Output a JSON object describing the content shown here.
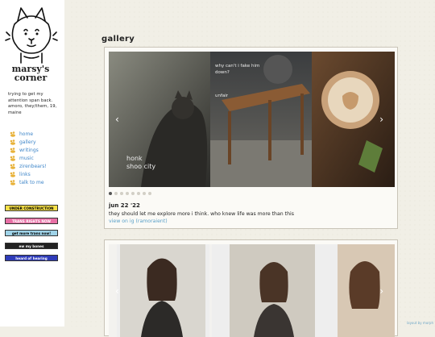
{
  "site": {
    "title_line1": "marsy's",
    "title_line2": "corner",
    "bio": "trying to get my attention span back. amoro, they/them, 19, maine"
  },
  "nav": {
    "items": [
      {
        "label": "home"
      },
      {
        "label": "gallery"
      },
      {
        "label": "writings"
      },
      {
        "label": "music"
      },
      {
        "label": "zirenbears!"
      },
      {
        "label": "links"
      },
      {
        "label": "talk to me"
      }
    ]
  },
  "badges": [
    {
      "label": "UNDER CONSTRUCTION"
    },
    {
      "label": "TRANS RIGHTS NOW"
    },
    {
      "label": "get more trans now!"
    },
    {
      "label": "ew my bones"
    },
    {
      "label": "heard of hearing"
    }
  ],
  "gallery": {
    "title": "gallery",
    "post": {
      "date": "jun 22 '22",
      "caption": "they should let me explore more i think. who knew life was more than this",
      "link": "view on ig (ramoraient)",
      "slide_text_1": "honk shoo city",
      "slide_text_2": "why can't i fake him down?",
      "slide_text_3": "unfair"
    },
    "prev_label": "‹",
    "next_label": "›",
    "dots_count": 8
  },
  "footer": {
    "credit": "layout by morph"
  },
  "colors": {
    "background": "#f1efe6",
    "link": "#3f86c9",
    "sidebar": "#ffffff"
  }
}
